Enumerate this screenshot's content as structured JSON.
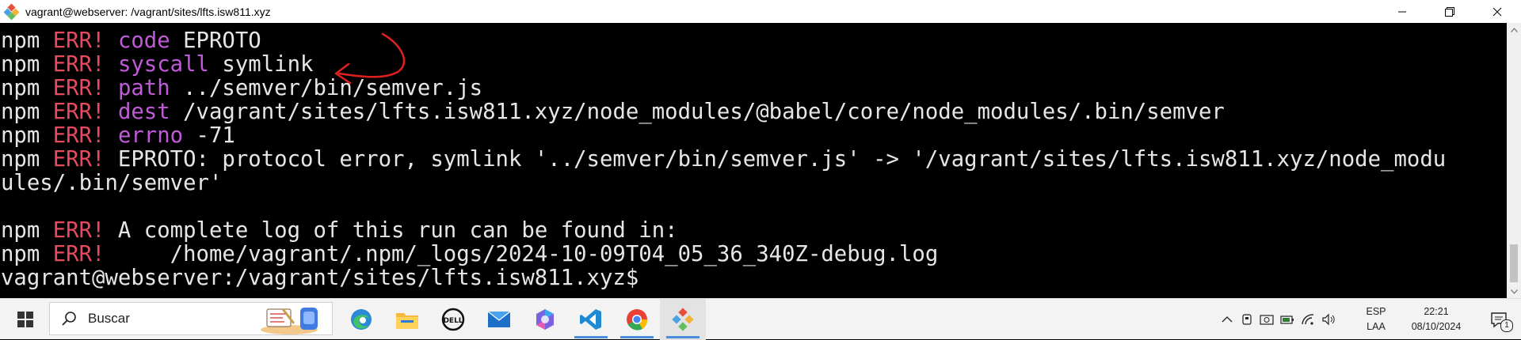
{
  "window": {
    "title": "vagrant@webserver: /vagrant/sites/lfts.isw811.xyz",
    "controls": [
      "minimize-icon",
      "restore-icon",
      "close-icon"
    ]
  },
  "terminal": {
    "lines": [
      {
        "prefix": "npm",
        "err": "ERR!",
        "key": "code",
        "value": " EPROTO"
      },
      {
        "prefix": "npm",
        "err": "ERR!",
        "key": "syscall",
        "value": " symlink"
      },
      {
        "prefix": "npm",
        "err": "ERR!",
        "key": "path",
        "value": " ../semver/bin/semver.js"
      },
      {
        "prefix": "npm",
        "err": "ERR!",
        "key": "dest",
        "value": " /vagrant/sites/lfts.isw811.xyz/node_modules/@babel/core/node_modules/.bin/semver"
      },
      {
        "prefix": "npm",
        "err": "ERR!",
        "key": "errno",
        "value": " -71"
      },
      {
        "prefix": "npm",
        "err": "ERR!",
        "key": "",
        "value": " EPROTO: protocol error, symlink '../semver/bin/semver.js' -> '/vagrant/sites/lfts.isw811.xyz/node_modu"
      },
      {
        "prefix": "",
        "err": "",
        "key": "",
        "value": "ules/.bin/semver'"
      },
      {
        "prefix": "",
        "err": "",
        "key": "",
        "value": ""
      },
      {
        "prefix": "npm",
        "err": "ERR!",
        "key": "",
        "value": " A complete log of this run can be found in:"
      },
      {
        "prefix": "npm",
        "err": "ERR!",
        "key": "",
        "value": "     /home/vagrant/.npm/_logs/2024-10-09T04_05_36_340Z-debug.log"
      },
      {
        "prefix": "",
        "err": "",
        "key": "",
        "value": "vagrant@webserver:/vagrant/sites/lfts.isw811.xyz$"
      }
    ],
    "colors": {
      "text": "#e6e6e6",
      "err": "#e84b5f",
      "key": "#c05ad8",
      "annotation": "#e0201e"
    }
  },
  "taskbar": {
    "search_placeholder": "Buscar",
    "apps": [
      "edge-icon",
      "file-explorer-icon",
      "dell-icon",
      "mail-icon",
      "copilot-icon",
      "vscode-icon",
      "chrome-icon",
      "git-icon"
    ],
    "language": {
      "line1": "ESP",
      "line2": "LAA"
    },
    "clock": {
      "time": "22:21",
      "date": "08/10/2024"
    },
    "notification_count": "1"
  }
}
